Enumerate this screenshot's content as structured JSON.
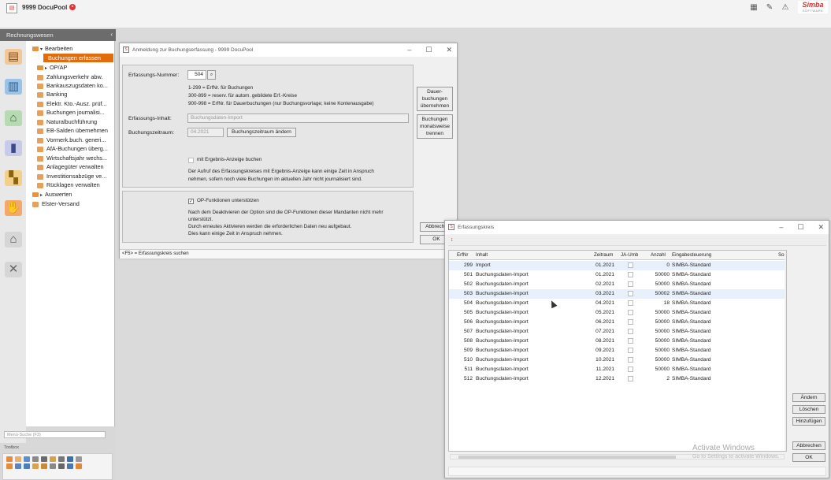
{
  "app": {
    "title": "9999 DocuPool",
    "brand_name": "Simba",
    "brand_sub": "SOFTWARE"
  },
  "nav": {
    "header": "Rechnungswesen",
    "items": [
      {
        "label": "Bearbeiten",
        "kind": "group",
        "arrow": "▾"
      },
      {
        "label": "Buchungen erfassen",
        "kind": "item",
        "selected": true
      },
      {
        "label": "OP/AP",
        "kind": "group",
        "arrow": "▸"
      },
      {
        "label": "Zahlungsverkehr abw.",
        "kind": "item"
      },
      {
        "label": "Bankauszugsdaten ko...",
        "kind": "item"
      },
      {
        "label": "Banking",
        "kind": "item"
      },
      {
        "label": "Elektr. Kto.-Ausz. prüf...",
        "kind": "item"
      },
      {
        "label": "Buchungen journalisi...",
        "kind": "item"
      },
      {
        "label": "Naturalbuchführung",
        "kind": "item"
      },
      {
        "label": "EB-Salden übernehmen",
        "kind": "item"
      },
      {
        "label": "Vormerk.buch. generi...",
        "kind": "item"
      },
      {
        "label": "AfA-Buchungen überg...",
        "kind": "item"
      },
      {
        "label": "Wirtschaftsjahr wechs...",
        "kind": "item"
      },
      {
        "label": "Anlagegüter verwalten",
        "kind": "item"
      },
      {
        "label": "Investitionsabzüge ve...",
        "kind": "item"
      },
      {
        "label": "Rücklagen verwalten",
        "kind": "item"
      },
      {
        "label": "Auswerten",
        "kind": "group",
        "arrow": "▸"
      },
      {
        "label": "Elster-Versand",
        "kind": "root"
      }
    ],
    "search_placeholder": "Menü-Suche (F3)",
    "toolbox_label": "Toolbox"
  },
  "dialog1": {
    "title": "Anmeldung zur Buchungserfassung - 9999 DocuPool",
    "erfassungs_nummer_label": "Erfassungs-Nummer:",
    "erfassungs_nummer_value": "504",
    "hint1": "1-299 = ErfNr. für Buchungen",
    "hint2": "300-899 = reserv. für autom. gebildete Erf.-Kreise",
    "hint3": "900-998 = ErfNr. für Dauerbuchungen (nur Buchungsvorlage; keine Kontenausgabe)",
    "inhalt_label": "Erfassungs-Inhalt:",
    "inhalt_value": "Buchungsdaten-Import",
    "zeitraum_label": "Buchungszeitraum:",
    "zeitraum_value": "04.2021",
    "zeitraum_button": "Buchungszeitraum ändern",
    "ergebnis_label": "mit Ergebnis-Anzeige buchen",
    "ergebnis_text1": "Der Aufruf des Erfassungskreises mit Ergebnis-Anzeige kann einige Zeit in Anspruch",
    "ergebnis_text2": "nehmen, sofern noch viele Buchungen im aktuellen Jahr nicht journalisiert sind.",
    "op_label": "OP-Funktionen unterstützen",
    "op_text1": "Nach dem Deaktivieren der Option sind die OP-Funktionen dieser Mandanten nicht mehr",
    "op_text2": "unterstützt.",
    "op_text3": "Durch erneutes Aktivieren werden die erforderlichen Daten neu aufgebaut.",
    "op_text4": "Dies kann einige Zeit in Anspruch nehmen.",
    "btn_dauer1": "Dauer-",
    "btn_dauer2": "buchungen",
    "btn_dauer3": "übernehmen",
    "btn_monat1": "Buchungen",
    "btn_monat2": "monatsweise",
    "btn_monat3": "trennen",
    "btn_abbrechen": "Abbreche",
    "btn_ok": "OK",
    "status": "<F5> = Erfassungskreis suchen"
  },
  "dialog2": {
    "title": "Erfassungskreis",
    "columns": [
      "ErfNr",
      "Inhalt",
      "Zeitraum",
      "JA-Umb",
      "Anzahl",
      "Eingabesteuerung",
      "So"
    ],
    "rows": [
      {
        "erfnr": "299",
        "inhalt": "Import",
        "zeitraum": "01.2021",
        "anzahl": "0",
        "steuerung": "SIMBA-Standard"
      },
      {
        "erfnr": "501",
        "inhalt": "Buchungsdaten-Import",
        "zeitraum": "01.2021",
        "anzahl": "50000",
        "steuerung": "SIMBA-Standard"
      },
      {
        "erfnr": "502",
        "inhalt": "Buchungsdaten-Import",
        "zeitraum": "02.2021",
        "anzahl": "50000",
        "steuerung": "SIMBA-Standard"
      },
      {
        "erfnr": "503",
        "inhalt": "Buchungsdaten-Import",
        "zeitraum": "03.2021",
        "anzahl": "50002",
        "steuerung": "SIMBA-Standard"
      },
      {
        "erfnr": "504",
        "inhalt": "Buchungsdaten-Import",
        "zeitraum": "04.2021",
        "anzahl": "18",
        "steuerung": "SIMBA-Standard"
      },
      {
        "erfnr": "505",
        "inhalt": "Buchungsdaten-Import",
        "zeitraum": "05.2021",
        "anzahl": "50000",
        "steuerung": "SIMBA-Standard"
      },
      {
        "erfnr": "506",
        "inhalt": "Buchungsdaten-Import",
        "zeitraum": "06.2021",
        "anzahl": "50000",
        "steuerung": "SIMBA-Standard"
      },
      {
        "erfnr": "507",
        "inhalt": "Buchungsdaten-Import",
        "zeitraum": "07.2021",
        "anzahl": "50000",
        "steuerung": "SIMBA-Standard"
      },
      {
        "erfnr": "508",
        "inhalt": "Buchungsdaten-Import",
        "zeitraum": "08.2021",
        "anzahl": "50000",
        "steuerung": "SIMBA-Standard"
      },
      {
        "erfnr": "509",
        "inhalt": "Buchungsdaten-Import",
        "zeitraum": "09.2021",
        "anzahl": "50000",
        "steuerung": "SIMBA-Standard"
      },
      {
        "erfnr": "510",
        "inhalt": "Buchungsdaten-Import",
        "zeitraum": "10.2021",
        "anzahl": "50000",
        "steuerung": "SIMBA-Standard"
      },
      {
        "erfnr": "511",
        "inhalt": "Buchungsdaten-Import",
        "zeitraum": "11.2021",
        "anzahl": "50000",
        "steuerung": "SIMBA-Standard"
      },
      {
        "erfnr": "512",
        "inhalt": "Buchungsdaten-Import",
        "zeitraum": "12.2021",
        "anzahl": "2",
        "steuerung": "SIMBA-Standard"
      }
    ],
    "btn_aendern": "Ändern",
    "btn_loeschen": "Löschen",
    "btn_hinzufuegen": "Hinzufügen",
    "btn_abbrechen": "Abbrechen",
    "btn_ok": "OK"
  },
  "watermark": {
    "line1": "Activate Windows",
    "line2": "Go to Settings to activate Windows."
  },
  "colors": {
    "accent": "#e36c0a",
    "nav_header": "#6c6c6c",
    "row_highlight": "#e8f0fb"
  }
}
